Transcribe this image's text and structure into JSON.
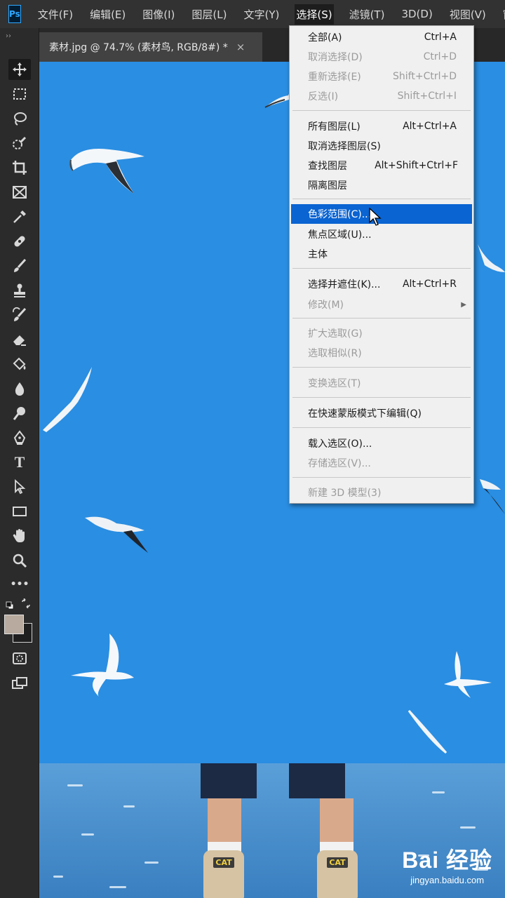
{
  "app": {
    "logo": "Ps"
  },
  "menubar": {
    "items": [
      "文件(F)",
      "编辑(E)",
      "图像(I)",
      "图层(L)",
      "文字(Y)",
      "选择(S)",
      "滤镜(T)",
      "3D(D)",
      "视图(V)",
      "窗"
    ]
  },
  "document_tab": {
    "title": "素材.jpg @ 74.7% (素材鸟, RGB/8#) *",
    "close": "×"
  },
  "toolbar": {
    "collapse": "››",
    "tools": [
      "move-tool",
      "marquee-tool",
      "lasso-tool",
      "quick-selection-tool",
      "crop-tool",
      "frame-tool",
      "eyedropper-tool",
      "healing-brush-tool",
      "brush-tool",
      "clone-stamp-tool",
      "history-brush-tool",
      "eraser-tool",
      "paint-bucket-tool",
      "blur-tool",
      "dodge-tool",
      "pen-tool",
      "type-tool",
      "path-selection-tool",
      "rectangle-tool",
      "hand-tool",
      "zoom-tool",
      "more-tools",
      "swap-colors",
      "foreground-color",
      "quick-mask",
      "screen-mode"
    ],
    "type_tool_glyph": "T",
    "more_glyph": "•••",
    "colors": {
      "foreground": "#b8aa9e",
      "background": "#1f1f1f"
    }
  },
  "select_menu": {
    "items": [
      {
        "label": "全部(A)",
        "shortcut": "Ctrl+A",
        "disabled": false
      },
      {
        "label": "取消选择(D)",
        "shortcut": "Ctrl+D",
        "disabled": true
      },
      {
        "label": "重新选择(E)",
        "shortcut": "Shift+Ctrl+D",
        "disabled": true
      },
      {
        "label": "反选(I)",
        "shortcut": "Shift+Ctrl+I",
        "disabled": true
      },
      {
        "label": "所有图层(L)",
        "shortcut": "Alt+Ctrl+A",
        "disabled": false
      },
      {
        "label": "取消选择图层(S)",
        "shortcut": "",
        "disabled": false
      },
      {
        "label": "查找图层",
        "shortcut": "Alt+Shift+Ctrl+F",
        "disabled": false
      },
      {
        "label": "隔离图层",
        "shortcut": "",
        "disabled": false
      },
      {
        "label": "色彩范围(C)...",
        "shortcut": "",
        "disabled": false
      },
      {
        "label": "焦点区域(U)...",
        "shortcut": "",
        "disabled": false
      },
      {
        "label": "主体",
        "shortcut": "",
        "disabled": false
      },
      {
        "label": "选择并遮住(K)...",
        "shortcut": "Alt+Ctrl+R",
        "disabled": false
      },
      {
        "label": "修改(M)",
        "shortcut": "",
        "disabled": true,
        "submenu_arrow": "▶"
      },
      {
        "label": "扩大选取(G)",
        "shortcut": "",
        "disabled": true
      },
      {
        "label": "选取相似(R)",
        "shortcut": "",
        "disabled": true
      },
      {
        "label": "变换选区(T)",
        "shortcut": "",
        "disabled": true
      },
      {
        "label": "在快速蒙版模式下编辑(Q)",
        "shortcut": "",
        "disabled": false
      },
      {
        "label": "载入选区(O)...",
        "shortcut": "",
        "disabled": false
      },
      {
        "label": "存储选区(V)...",
        "shortcut": "",
        "disabled": true
      },
      {
        "label": "新建 3D 模型(3)",
        "shortcut": "",
        "disabled": true
      }
    ],
    "hovered": "色彩范围(C)..."
  },
  "canvas": {
    "sky_color": "#2a8ee2",
    "shoe_brand": "CAT",
    "shoe_brand_right": "CAT"
  },
  "watermark": {
    "logo": "Bai 经验",
    "url": "jingyan.baidu.com"
  }
}
